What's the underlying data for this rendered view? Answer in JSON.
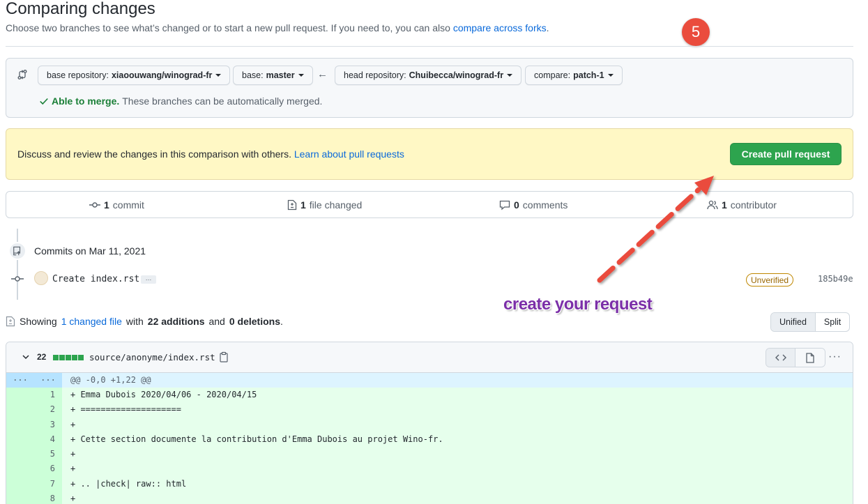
{
  "page": {
    "title": "Comparing changes",
    "subtitle": "Choose two branches to see what’s changed or to start a new pull request. If you need to, you can also",
    "subtitle_link": "compare across forks",
    "subtitle_end": "."
  },
  "annotation": {
    "step_number": "5",
    "callout": "create your request",
    "color": "#ea4c3d"
  },
  "range": {
    "base_repo_label": "base repository:",
    "base_repo_value": "xiaoouwang/winograd-fr",
    "base_label": "base:",
    "base_value": "master",
    "head_repo_label": "head repository:",
    "head_repo_value": "Chuibecca/winograd-fr",
    "compare_label": "compare:",
    "compare_value": "patch-1",
    "merge_status": "Able to merge.",
    "merge_detail": "These branches can be automatically merged."
  },
  "flash": {
    "text": "Discuss and review the changes in this comparison with others.",
    "link": "Learn about pull requests",
    "button": "Create pull request"
  },
  "stats": {
    "commits_count": "1",
    "commits_label": "commit",
    "files_count": "1",
    "files_label": "file changed",
    "comments_count": "0",
    "comments_label": "comments",
    "contributors_count": "1",
    "contributors_label": "contributor"
  },
  "commits": {
    "group_label": "Commits on Mar 11, 2021",
    "items": [
      {
        "message": "Create index.rst",
        "ellipsis": "…",
        "status": "Unverified",
        "sha": "185b49e"
      }
    ]
  },
  "summary": {
    "prefix": "Showing",
    "changed_link": "1 changed file",
    "with": "with",
    "additions": "22 additions",
    "and": "and",
    "deletions": "0 deletions",
    "end": ".",
    "view_unified": "Unified",
    "view_split": "Split"
  },
  "file": {
    "count": "22",
    "path": "source/anonyme/index.rst",
    "more": "···",
    "hunk_left": "...",
    "hunk_right": "...",
    "hunk_header": "@@ -0,0 +1,22 @@",
    "lines": [
      {
        "n": "1",
        "text": "+ Emma Dubois 2020/04/06 - 2020/04/15"
      },
      {
        "n": "2",
        "text": "+ ===================="
      },
      {
        "n": "3",
        "text": "+"
      },
      {
        "n": "4",
        "text": "+ Cette section documente la contribution d'Emma Dubois au projet Wino-fr."
      },
      {
        "n": "5",
        "text": "+"
      },
      {
        "n": "6",
        "text": "+"
      },
      {
        "n": "7",
        "text": "+ .. |check| raw:: html"
      },
      {
        "n": "8",
        "text": "+"
      }
    ]
  }
}
